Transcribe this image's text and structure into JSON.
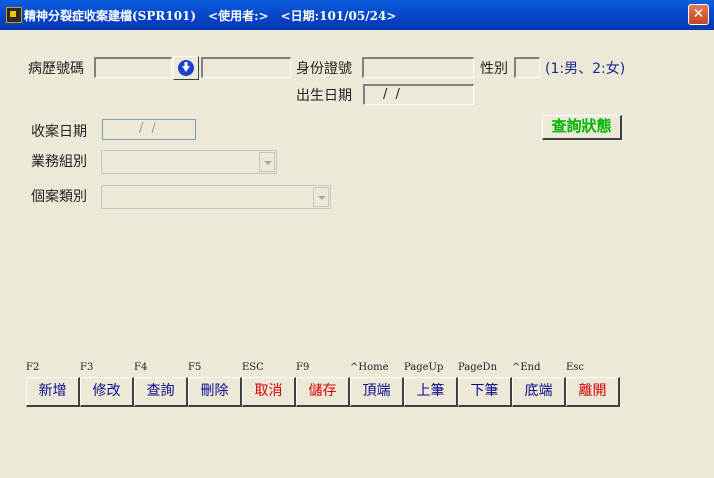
{
  "window": {
    "title": "精神分裂症收案建檔(SPR101)　<使用者:>　<日期:101/05/24>",
    "close_glyph": "✕"
  },
  "form": {
    "chart_no_label": "病歷號碼",
    "chart_no_value": "",
    "name_value": "",
    "id_label": "身份證號",
    "id_value": "",
    "gender_label": "性別",
    "gender_value": "",
    "gender_hint": "(1:男、2:女)",
    "birth_label": "出生日期",
    "birth_value": "/ /",
    "case_date_label": "收案日期",
    "case_date_value": "/   /",
    "business_group_label": "業務組別",
    "business_group_value": "",
    "case_type_label": "個案類別",
    "case_type_value": ""
  },
  "status_button": {
    "label": "查詢狀態"
  },
  "toolbar": [
    {
      "key": "F2",
      "label": "新增",
      "color": "#0a0a8c"
    },
    {
      "key": "F3",
      "label": "修改",
      "color": "#0a0a8c"
    },
    {
      "key": "F4",
      "label": "查詢",
      "color": "#0a0a8c"
    },
    {
      "key": "F5",
      "label": "刪除",
      "color": "#0a0a8c"
    },
    {
      "key": "ESC",
      "label": "取消",
      "color": "#d40000"
    },
    {
      "key": "F9",
      "label": "儲存",
      "color": "#d40000"
    },
    {
      "key": "^Home",
      "label": "頂端",
      "color": "#0a0a8c"
    },
    {
      "key": "PageUp",
      "label": "上筆",
      "color": "#0a0a8c"
    },
    {
      "key": "PageDn",
      "label": "下筆",
      "color": "#0a0a8c"
    },
    {
      "key": "^End",
      "label": "底端",
      "color": "#0a0a8c"
    },
    {
      "key": "Esc",
      "label": "離開",
      "color": "#d40000"
    }
  ],
  "icons": {
    "app": "app-icon",
    "lookup": "arrow-down-icon",
    "dropdown": "chevron-down-icon"
  }
}
